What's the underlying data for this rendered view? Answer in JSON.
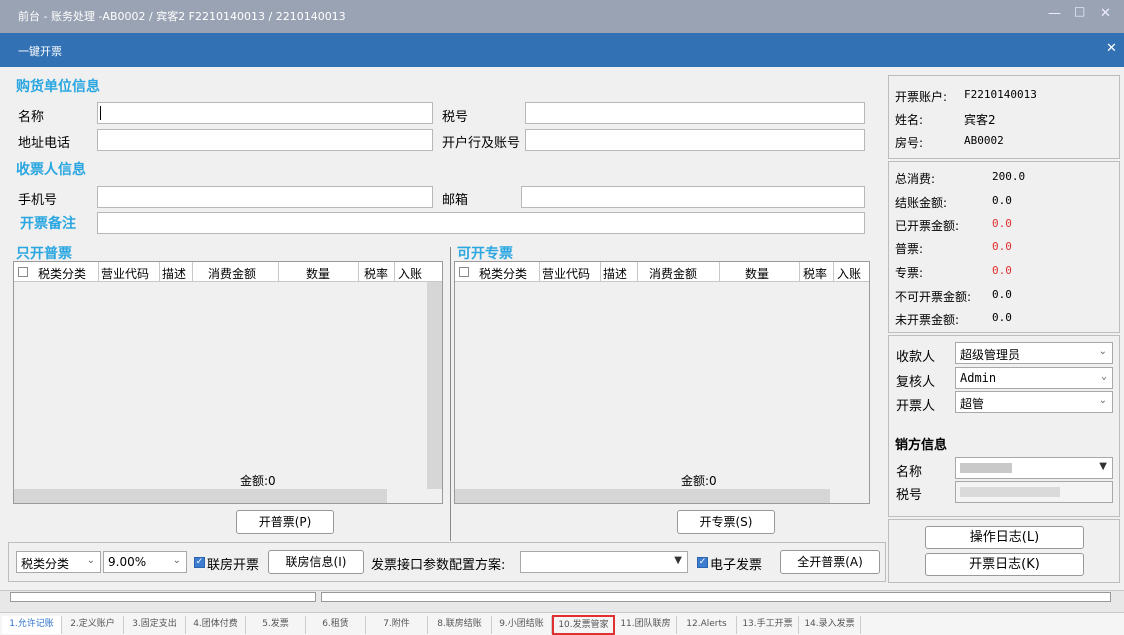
{
  "window": {
    "title": "前台 - 账务处理 -AB0002 / 宾客2 F2210140013 / 2210140013"
  },
  "dialog": {
    "title": "一键开票"
  },
  "buyer": {
    "section_title": "购货单位信息",
    "name_label": "名称",
    "name_value": "",
    "tax_no_label": "税号",
    "tax_no_value": "",
    "address_label": "地址电话",
    "address_value": "",
    "bank_label": "开户行及账号",
    "bank_value": ""
  },
  "receiver": {
    "section_title": "收票人信息",
    "phone_label": "手机号",
    "phone_value": "",
    "email_label": "邮箱",
    "email_value": ""
  },
  "remark": {
    "label": "开票备注",
    "value": ""
  },
  "grid_normal": {
    "title": "只开普票",
    "columns": [
      "税类分类",
      "营业代码",
      "描述",
      "消费金额",
      "数量",
      "税率",
      "入账"
    ],
    "total": "金额:0",
    "button": "开普票(P)"
  },
  "grid_special": {
    "title": "可开专票",
    "columns": [
      "税类分类",
      "营业代码",
      "描述",
      "消费金额",
      "数量",
      "税率",
      "入账"
    ],
    "total": "金额:0",
    "button": "开专票(S)"
  },
  "bottom": {
    "tax_class": "税类分类",
    "tax_rate": "9.00%",
    "joint_room_label": "联房开票",
    "joint_info_button": "联房信息(I)",
    "interface_label": "发票接口参数配置方案:",
    "interface_value": "",
    "e_invoice_label": "电子发票",
    "open_all_button": "全开普票(A)"
  },
  "account": {
    "account_label": "开票账户:",
    "account_value": "F2210140013",
    "name_label": "姓名:",
    "name_value": "宾客2",
    "room_label": "房号:",
    "room_value": "AB0002"
  },
  "amounts": {
    "total_label": "总消费:",
    "total_value": "200.0",
    "checkout_label": "结账金额:",
    "checkout_value": "0.0",
    "invoiced_label": "已开票金额:",
    "invoiced_value": "0.0",
    "normal_label": "普票:",
    "normal_value": "0.0",
    "special_label": "专票:",
    "special_value": "0.0",
    "noinvoice_label": "不可开票金额:",
    "noinvoice_value": "0.0",
    "uninvoiced_label": "未开票金额:",
    "uninvoiced_value": "0.0"
  },
  "people": {
    "payee_label": "收款人",
    "payee_value": "超级管理员",
    "reviewer_label": "复核人",
    "reviewer_value": "Admin",
    "drawer_label": "开票人",
    "drawer_value": "超管"
  },
  "seller": {
    "title": "销方信息",
    "name_label": "名称",
    "tax_label": "税号"
  },
  "logs": {
    "op_log_button": "操作日志(L)",
    "invoice_log_button": "开票日志(K)"
  },
  "tabs": [
    "1.允许记账",
    "2.定义账户",
    "3.固定支出",
    "4.团体付费",
    "5.发票",
    "6.租赁",
    "7.附件",
    "8.联房结账",
    "9.小团结账",
    "10.发票管家",
    "11.团队联房",
    "12.Alerts",
    "13.手工开票",
    "14.录入发票"
  ],
  "colors": {
    "title_bar": "#9aa3b4",
    "dialog_header": "#3271b4",
    "section": "#2aa6e0",
    "highlight": "#e03030"
  }
}
